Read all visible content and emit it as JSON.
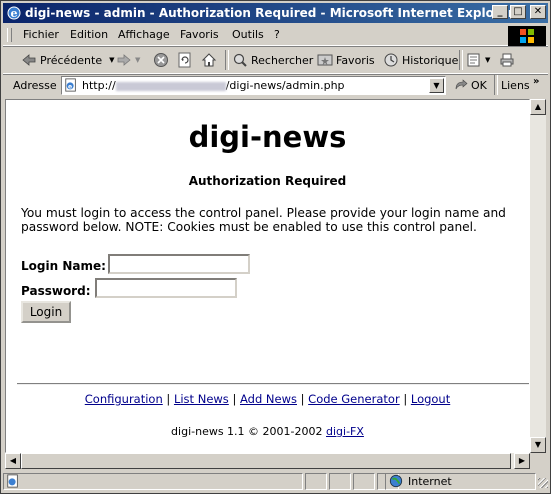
{
  "window": {
    "title": "digi-news - admin - Authorization Required - Microsoft Internet Explorer",
    "controls": {
      "minimize": "_",
      "maximize": "□",
      "close": "✕"
    }
  },
  "menu": [
    "Fichier",
    "Edition",
    "Affichage",
    "Favoris",
    "Outils",
    "?"
  ],
  "toolbar": {
    "back_label": "Précédente",
    "search_label": "Rechercher",
    "favorites_label": "Favoris",
    "history_label": "Historique"
  },
  "address": {
    "label": "Adresse",
    "url_prefix": "http://",
    "url_suffix": "/digi-news/admin.php",
    "go_label": "OK",
    "links_label": "Liens"
  },
  "page": {
    "heading": "digi-news",
    "subheading": "Authorization Required",
    "message": "You must login to access the control panel. Please provide your login name and password below. NOTE: Cookies must be enabled to use this control panel.",
    "login_name_label": "Login Name:",
    "password_label": "Password:",
    "login_button": "Login",
    "nav_links": [
      "Configuration",
      "List News",
      "Add News",
      "Code Generator",
      "Logout"
    ],
    "nav_separator": "|",
    "footer_text": "digi-news 1.1 © 2001-2002",
    "footer_link": "digi-FX"
  },
  "status": {
    "zone": "Internet"
  }
}
